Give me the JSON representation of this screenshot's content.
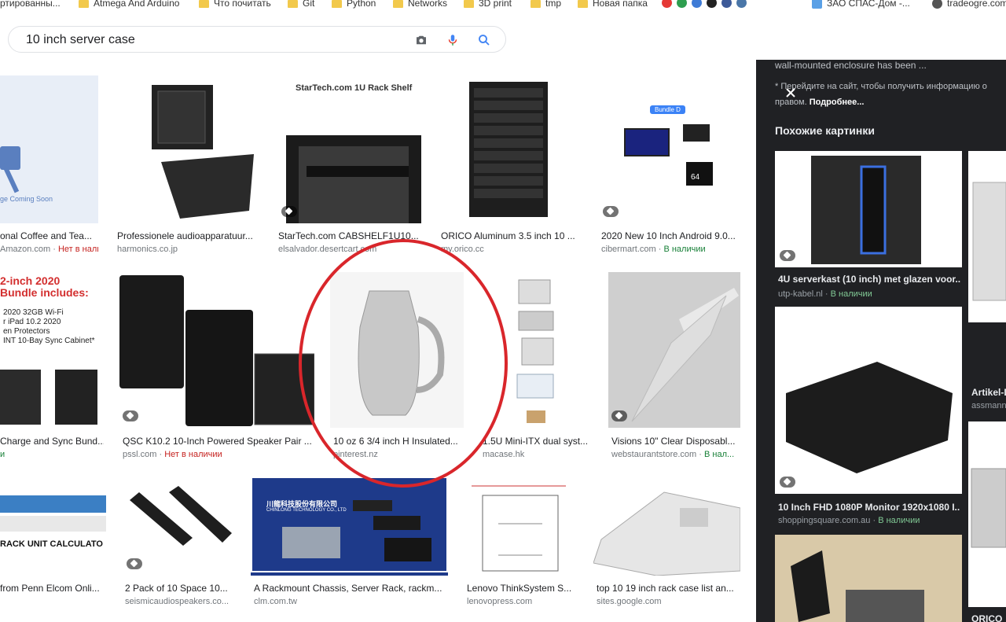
{
  "bookmarks": [
    {
      "label": "ртированны...",
      "type": "folder"
    },
    {
      "label": "Atmega And Arduino",
      "type": "folder"
    },
    {
      "label": "Что почитать",
      "type": "folder"
    },
    {
      "label": "Git",
      "type": "folder"
    },
    {
      "label": "Python",
      "type": "folder"
    },
    {
      "label": "Networks",
      "type": "folder"
    },
    {
      "label": "3D print",
      "type": "folder"
    },
    {
      "label": "tmp",
      "type": "folder"
    },
    {
      "label": "Новая папка",
      "type": "folder"
    },
    {
      "label": "ЗАО СПАС-Дом -...",
      "type": "site"
    },
    {
      "label": "tradeogre.com",
      "type": "site"
    }
  ],
  "search": {
    "query": "10 inch server case"
  },
  "results": [
    {
      "caption": "onal Coffee and Tea...",
      "source": "Amazon.com",
      "stock": "Нет в наличии",
      "stock_type": "no"
    },
    {
      "caption": "Professionele audioapparatuur...",
      "source": "harmonics.co.jp",
      "stock": "",
      "stock_type": ""
    },
    {
      "caption": "StarTech.com CABSHELF1U10...",
      "source": "elsalvador.desertcart.com",
      "stock": "",
      "stock_type": ""
    },
    {
      "caption": "ORICO Aluminum 3.5 inch 10 ...",
      "source": "my.orico.cc",
      "stock": "",
      "stock_type": ""
    },
    {
      "caption": "2020 New 10 Inch Android 9.0...",
      "source": "cibermart.com",
      "stock": "В наличии",
      "stock_type": "yes"
    },
    {
      "caption": "Charge and Sync Bund...",
      "source": "",
      "stock": "",
      "stock_type": ""
    },
    {
      "caption": "QSC K10.2 10-Inch Powered Speaker Pair ...",
      "source": "pssl.com",
      "stock": "Нет в наличии",
      "stock_type": "no"
    },
    {
      "caption": "10 oz 6 3/4 inch H Insulated...",
      "source": "pinterest.nz",
      "stock": "",
      "stock_type": ""
    },
    {
      "caption": "1.5U Mini-ITX dual syst...",
      "source": "macase.hk",
      "stock": "",
      "stock_type": ""
    },
    {
      "caption": "Visions 10\" Clear Disposabl...",
      "source": "webstaurantstore.com",
      "stock": "В нал...",
      "stock_type": "yes"
    },
    {
      "caption": "from Penn Elcom Onli...",
      "source": "",
      "stock": "",
      "stock_type": ""
    },
    {
      "caption": "2 Pack of 10 Space 10...",
      "source": "seismicaudiospeakers.co...",
      "stock": "",
      "stock_type": ""
    },
    {
      "caption": "A Rackmount Chassis, Server Rack, rackm...",
      "source": "clm.com.tw",
      "stock": "",
      "stock_type": ""
    },
    {
      "caption": "Lenovo ThinkSystem S...",
      "source": "lenovopress.com",
      "stock": "",
      "stock_type": ""
    },
    {
      "caption": "top 10 19 inch rack case list an...",
      "source": "sites.google.com",
      "stock": "",
      "stock_type": ""
    }
  ],
  "thumb_text": {
    "coming_soon": "ge Coming Soon",
    "startech_title": "StarTech.com 1U Rack Shelf",
    "bundle": "Bundle D",
    "memory": "64",
    "ipad_line1": "2-inch 2020",
    "ipad_line2": "Bundle includes:",
    "ipad_line3": "2020 32GB Wi-Fi",
    "ipad_line4": "r iPad 10.2 2020",
    "ipad_line5": "en Protectors",
    "ipad_line6": "INT 10-Bay Sync Cabinet*",
    "rack_calc": "RACK UNIT CALCULATO",
    "chinlong": "川龍科技股份有限公司",
    "chinlong_en": "CHINLONG TECHNOLOGY CO., LTD"
  },
  "panel": {
    "desc": "wall-mounted enclosure has been ...",
    "note": "* Перейдите на сайт, чтобы получить информацию о",
    "note2": "правом.",
    "more": "Подробнее...",
    "similar_title": "Похожие картинки",
    "items": [
      {
        "caption": "4U serverkast (10 inch) met glazen voor...",
        "source": "utp-kabel.nl",
        "stock": "В наличии"
      },
      {
        "caption": "10 Inch FHD 1080P Monitor 1920x1080 I...",
        "source": "shoppingsquare.com.au",
        "stock": "В наличии"
      },
      {
        "caption": "Artikel-D",
        "source": "assmann",
        "stock": ""
      },
      {
        "caption": "ORICO",
        "source": "",
        "stock": ""
      }
    ]
  }
}
